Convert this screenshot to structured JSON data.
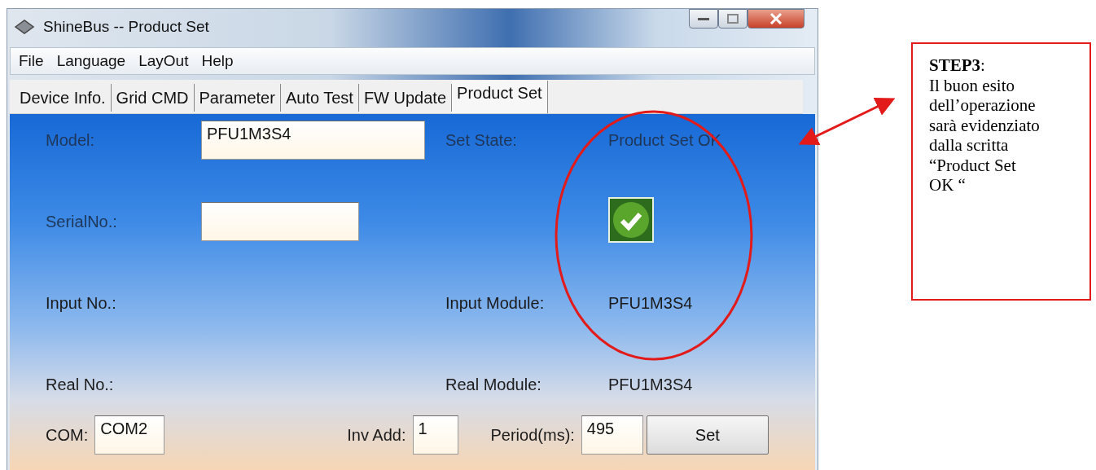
{
  "window": {
    "title": "ShineBus -- Product Set"
  },
  "menu": [
    "File",
    "Language",
    "LayOut",
    "Help"
  ],
  "tabs": [
    {
      "label": "Device Info.",
      "selected": false
    },
    {
      "label": "Grid CMD",
      "selected": false
    },
    {
      "label": "Parameter",
      "selected": false
    },
    {
      "label": "Auto Test",
      "selected": false
    },
    {
      "label": "FW Update",
      "selected": false
    },
    {
      "label": "Product Set",
      "selected": true
    }
  ],
  "form": {
    "model": {
      "label": "Model:",
      "value": "PFU1M3S4"
    },
    "set_state": {
      "label": "Set State:",
      "value": "Product Set OK",
      "success": true
    },
    "serial": {
      "label": "SerialNo.:"
    },
    "input_no": {
      "label": "Input No.:"
    },
    "input_module": {
      "label": "Input Module:",
      "value": "PFU1M3S4"
    },
    "real_no": {
      "label": "Real No.:"
    },
    "real_module": {
      "label": "Real Module:",
      "value": "PFU1M3S4"
    },
    "com": {
      "label": "COM:",
      "value": "COM2"
    },
    "inv_add": {
      "label": "Inv Add:",
      "value": "1"
    },
    "period": {
      "label": "Period(ms):",
      "value": "495"
    },
    "set_button": "Set"
  },
  "callout": {
    "lines": [
      "**STEP3**:",
      "Il buon esito",
      "dell’operazione",
      "sarà evidenziato",
      "dalla scritta",
      "“Product Set",
      "OK “"
    ]
  }
}
